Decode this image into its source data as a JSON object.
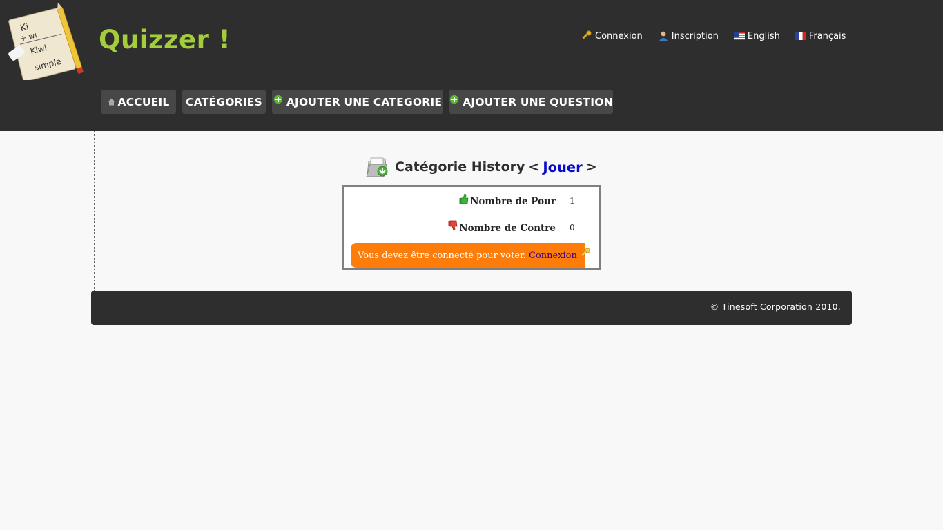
{
  "header": {
    "title": "Quizzer !",
    "logo_text": [
      "Ki",
      "+ wi",
      "Kiwi",
      "simple"
    ],
    "top_links": [
      {
        "label": "Connexion",
        "icon": "key-icon"
      },
      {
        "label": "Inscription",
        "icon": "user-icon"
      },
      {
        "label": "English",
        "icon": "us-flag-icon"
      },
      {
        "label": "Français",
        "icon": "fr-flag-icon"
      }
    ],
    "nav": [
      {
        "label": "ACCUEIL",
        "icon": "home-icon"
      },
      {
        "label": "CATÉGORIES",
        "icon": ""
      },
      {
        "label": "AJOUTER UNE CATEGORIE",
        "icon": "add-icon"
      },
      {
        "label": "AJOUTER UNE QUESTION",
        "icon": "add-icon"
      }
    ]
  },
  "category": {
    "title": "Catégorie History",
    "prev_arrow": "<",
    "play_label": "Jouer",
    "next_arrow": ">"
  },
  "votes": {
    "for_label": "Nombre de Pour",
    "for_value": "1",
    "against_label": "Nombre de Contre",
    "against_value": "0",
    "login_notice": "Vous devez être connecté pour voter.",
    "login_link": "Connexion"
  },
  "footer": {
    "copyright": "© Tinesoft Corporation 2010."
  },
  "colors": {
    "header_bg": "#2e2e2e",
    "title": "#a3cd3a",
    "nav_button": "#474747",
    "warning": "#fd7c0a",
    "link": "#0a0acc"
  }
}
